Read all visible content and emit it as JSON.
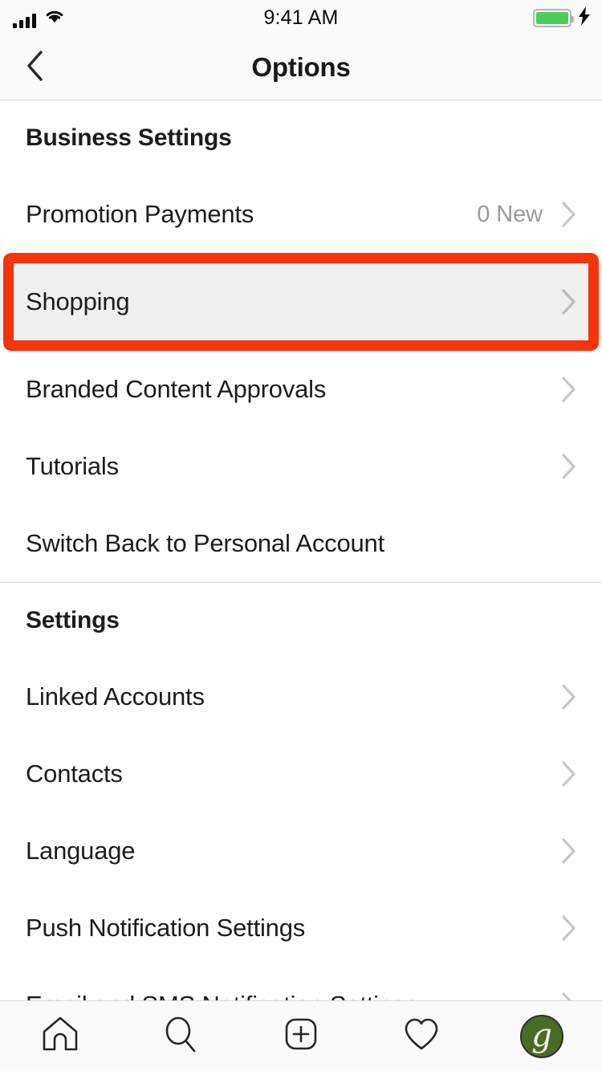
{
  "status_bar": {
    "time": "9:41 AM",
    "signal_icon": "cellular-signal-icon",
    "signal_bars": 4,
    "wifi_icon": "wifi-icon",
    "battery_icon": "battery-full-icon",
    "battery_color": "#4ccc5f",
    "charging_icon": "charging-bolt-icon"
  },
  "nav_bar": {
    "back_icon": "back-chevron-icon",
    "title": "Options"
  },
  "sections": [
    {
      "header": "Business Settings",
      "rows": [
        {
          "label": "Promotion Payments",
          "value": "0 New",
          "chevron": true,
          "highlighted": false
        },
        {
          "label": "Shopping",
          "value": "",
          "chevron": true,
          "highlighted": true
        },
        {
          "label": "Branded Content Approvals",
          "value": "",
          "chevron": true,
          "highlighted": false
        },
        {
          "label": "Tutorials",
          "value": "",
          "chevron": true,
          "highlighted": false
        },
        {
          "label": "Switch Back to Personal Account",
          "value": "",
          "chevron": false,
          "highlighted": false
        }
      ]
    },
    {
      "header": "Settings",
      "rows": [
        {
          "label": "Linked Accounts",
          "value": "",
          "chevron": true,
          "highlighted": false
        },
        {
          "label": "Contacts",
          "value": "",
          "chevron": true,
          "highlighted": false
        },
        {
          "label": "Language",
          "value": "",
          "chevron": true,
          "highlighted": false
        },
        {
          "label": "Push Notification Settings",
          "value": "",
          "chevron": true,
          "highlighted": false
        },
        {
          "label": "Email and SMS Notification Settings",
          "value": "",
          "chevron": true,
          "highlighted": false
        }
      ]
    }
  ],
  "highlight": {
    "color": "#f5340d",
    "target_label": "Shopping",
    "row_background": "#efefef"
  },
  "tab_bar": {
    "items": [
      {
        "icon": "home-icon",
        "label": "Home"
      },
      {
        "icon": "search-icon",
        "label": "Search"
      },
      {
        "icon": "add-post-icon",
        "label": "New Post"
      },
      {
        "icon": "heart-activity-icon",
        "label": "Activity"
      },
      {
        "icon": "profile-avatar-icon",
        "label": "Profile"
      }
    ],
    "avatar_letter": "g",
    "avatar_color": "#4a6b25"
  }
}
